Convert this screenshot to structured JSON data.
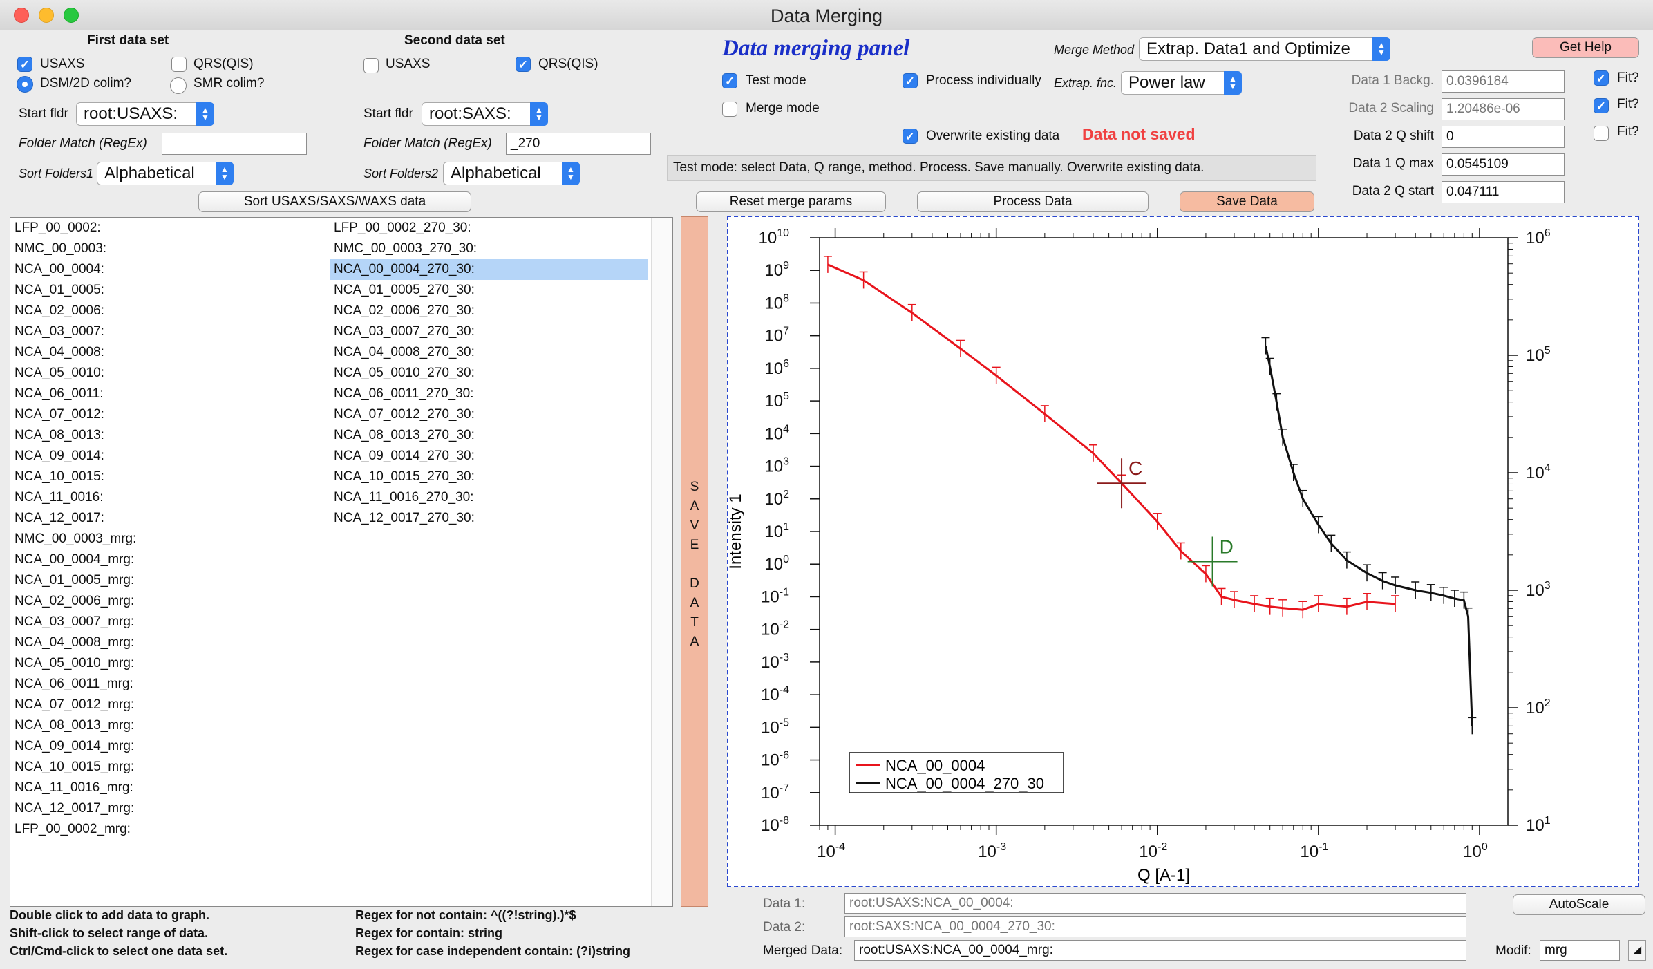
{
  "window": {
    "title": "Data Merging"
  },
  "first": {
    "header": "First data set",
    "usaxs": "USAXS",
    "qrs": "QRS(QIS)",
    "dsm": "DSM/2D colim?",
    "smr": "SMR colim?",
    "start_label": "Start fldr",
    "start_value": "root:USAXS:",
    "match_label": "Folder Match (RegEx)",
    "match_value": "",
    "sort_label": "Sort Folders1",
    "sort_value": "Alphabetical"
  },
  "second": {
    "header": "Second data set",
    "usaxs": "USAXS",
    "qrs": "QRS(QIS)",
    "start_label": "Start fldr",
    "start_value": "root:SAXS:",
    "match_label": "Folder Match (RegEx)",
    "match_value": "_270",
    "sort_label": "Sort Folders2",
    "sort_value": "Alphabetical"
  },
  "sort_button": "Sort USAXS/SAXS/WAXS data",
  "panel": {
    "title": "Data merging  panel",
    "test_mode": "Test mode",
    "merge_mode": "Merge mode",
    "process_individually": "Process individually",
    "overwrite": "Overwrite existing data",
    "not_saved": "Data not saved",
    "merge_method_label": "Merge Method",
    "merge_method_value": "Extrap. Data1 and Optimize",
    "extrap_label": "Extrap. fnc.",
    "extrap_value": "Power law",
    "status": "Test mode: select Data, Q range, method. Process. Save manually. Overwrite existing data."
  },
  "buttons": {
    "reset": "Reset merge params",
    "process": "Process Data",
    "save": "Save Data",
    "help": "Get Help",
    "autoscale": "AutoScale",
    "save_bar": [
      "S",
      "A",
      "V",
      "E",
      "",
      "D",
      "A",
      "T",
      "A"
    ]
  },
  "params": {
    "bkg_label": "Data 1 Backg.",
    "bkg_value": "0.0396184",
    "scale_label": "Data 2 Scaling",
    "scale_value": "1.20486e-06",
    "qshift_label": "Data 2 Q shift",
    "qshift_value": "0",
    "qmax_label": "Data 1 Q max",
    "qmax_value": "0.0545109",
    "qstart_label": "Data 2 Q start",
    "qstart_value": "0.047111",
    "fit": "Fit?"
  },
  "list_left": [
    "LFP_00_0002:",
    "NMC_00_0003:",
    "NCA_00_0004:",
    "NCA_01_0005:",
    "NCA_02_0006:",
    "NCA_03_0007:",
    "NCA_04_0008:",
    "NCA_05_0010:",
    "NCA_06_0011:",
    "NCA_07_0012:",
    "NCA_08_0013:",
    "NCA_09_0014:",
    "NCA_10_0015:",
    "NCA_11_0016:",
    "NCA_12_0017:",
    "NMC_00_0003_mrg:",
    "NCA_00_0004_mrg:",
    "NCA_01_0005_mrg:",
    "NCA_02_0006_mrg:",
    "NCA_03_0007_mrg:",
    "NCA_04_0008_mrg:",
    "NCA_05_0010_mrg:",
    "NCA_06_0011_mrg:",
    "NCA_07_0012_mrg:",
    "NCA_08_0013_mrg:",
    "NCA_09_0014_mrg:",
    "NCA_10_0015_mrg:",
    "NCA_11_0016_mrg:",
    "NCA_12_0017_mrg:",
    "LFP_00_0002_mrg:"
  ],
  "list_right": [
    "LFP_00_0002_270_30:",
    "NMC_00_0003_270_30:",
    "NCA_00_0004_270_30:",
    "NCA_01_0005_270_30:",
    "NCA_02_0006_270_30:",
    "NCA_03_0007_270_30:",
    "NCA_04_0008_270_30:",
    "NCA_05_0010_270_30:",
    "NCA_06_0011_270_30:",
    "NCA_07_0012_270_30:",
    "NCA_08_0013_270_30:",
    "NCA_09_0014_270_30:",
    "NCA_10_0015_270_30:",
    "NCA_11_0016_270_30:",
    "NCA_12_0017_270_30:"
  ],
  "selected_right_index": 2,
  "help_text": {
    "l1": "Double click to add data to graph.",
    "l2": "Shift-click to select range of data.",
    "l3": "Ctrl/Cmd-click to select one data set.",
    "r1": "Regex for not contain: ^((?!string).)*$",
    "r2": "Regex for contain:  string",
    "r3": "Regex for case independent contain:  (?i)string"
  },
  "bottom": {
    "d1_label": "Data 1:",
    "d1_value": "root:USAXS:NCA_00_0004:",
    "d2_label": "Data 2:",
    "d2_value": "root:SAXS:NCA_00_0004_270_30:",
    "m_label": "Merged Data:",
    "m_value": "root:USAXS:NCA_00_0004_mrg:",
    "modif_label": "Modif:",
    "modif_value": "mrg"
  },
  "chart_data": {
    "type": "line",
    "xlabel": "Q [A-1]",
    "ylabel": "Intensity 1",
    "x_scale": "log",
    "y_scale": "log",
    "y2_scale": "log",
    "xlim": [
      8e-05,
      1.5
    ],
    "ylim": [
      1e-08,
      10000000000.0
    ],
    "y2lim": [
      10,
      1000000
    ],
    "x_ticks": [
      "10-4",
      "10-3",
      "10-2",
      "10-1",
      "100"
    ],
    "y_ticks": [
      "10-8",
      "10-7",
      "10-6",
      "10-5",
      "10-4",
      "10-3",
      "10-2",
      "10-1",
      "100",
      "101",
      "102",
      "103",
      "104",
      "105",
      "106",
      "107",
      "108",
      "109",
      "1010"
    ],
    "y2_ticks": [
      "101",
      "102",
      "103",
      "104",
      "105",
      "106"
    ],
    "legend_position": "bottom-left",
    "series": [
      {
        "name": "NCA_00_0004",
        "color": "#e8141c",
        "axis": "left",
        "x": [
          9e-05,
          0.00015,
          0.0003,
          0.0006,
          0.001,
          0.002,
          0.004,
          0.006,
          0.01,
          0.014,
          0.02,
          0.025,
          0.03,
          0.04,
          0.05,
          0.06,
          0.08,
          0.1,
          0.15,
          0.2,
          0.3
        ],
        "y": [
          1500000000.0,
          500000000.0,
          50000000.0,
          4000000.0,
          600000.0,
          40000.0,
          2500.0,
          300.0,
          20.0,
          2.5,
          0.5,
          0.1,
          0.08,
          0.06,
          0.05,
          0.045,
          0.04,
          0.06,
          0.05,
          0.07,
          0.06
        ]
      },
      {
        "name": "NCA_00_0004_270_30",
        "color": "#111111",
        "axis": "right",
        "x": [
          0.047,
          0.05,
          0.055,
          0.06,
          0.07,
          0.08,
          0.1,
          0.12,
          0.15,
          0.2,
          0.25,
          0.3,
          0.4,
          0.5,
          0.6,
          0.7,
          0.8,
          0.85,
          0.9
        ],
        "y": [
          120000,
          80000,
          40000,
          20000,
          10000,
          6000,
          3600,
          2500,
          1800,
          1400,
          1200,
          1100,
          1000,
          950,
          900,
          850,
          820,
          600,
          70
        ]
      }
    ],
    "cursors": [
      {
        "label": "C",
        "color": "#8a1a1a",
        "x": 0.006,
        "y": 300
      },
      {
        "label": "D",
        "color": "#2a7a2a",
        "x": 0.022,
        "y": 1.2
      }
    ]
  }
}
